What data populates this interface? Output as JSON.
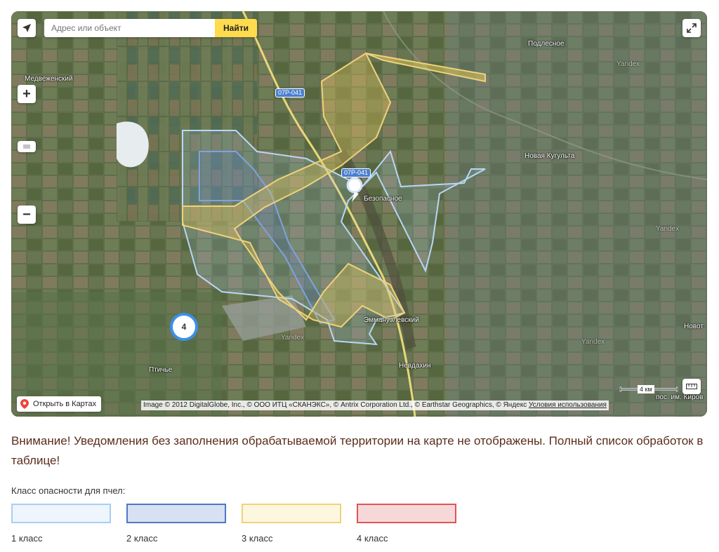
{
  "search": {
    "placeholder": "Адрес или объект",
    "button": "Найти"
  },
  "map_labels": {
    "podlesnoe": "Подлесное",
    "medvezhensky": "Медвеженский",
    "novaya_kugulta": "Новая Кугульта",
    "bezopasnoe": "Безопасное",
    "emmanuelevsky": "Эммануэлевский",
    "novot": "Новот",
    "ptichye": "Птичье",
    "nevdakhin": "Невдахин",
    "pos_im_kirova": "пос. им. Киров",
    "yandex1": "Yandex",
    "yandex2": "Yandex",
    "yandex3": "Yandex",
    "yandex4": "Yandex"
  },
  "road_badges": {
    "r1": "07Р-041",
    "r2": "07Р-041"
  },
  "cluster_count": "4",
  "open_in_maps": "Открыть в Картах",
  "copyright": {
    "text": "Image © 2012 DigitalGlobe, Inc., © ООО ИТЦ «СКАНЭКС», © Antrix Corporation Ltd., © Earthstar Geographics, © Яндекс ",
    "terms": "Условия использования"
  },
  "scale": "4 км",
  "zoom": {
    "plus": "+",
    "minus": "−"
  },
  "warning": "Внимание! Уведомления без заполнения обрабатываемой территории на карте не отображены. Полный список обработок в таблице!",
  "legend": {
    "title": "Класс опасности для пчел:",
    "items": [
      {
        "label": "1 класс",
        "fill": "#eef5fd",
        "border": "#a9cdf2"
      },
      {
        "label": "2 класс",
        "fill": "#d7e1f3",
        "border": "#4c79c4"
      },
      {
        "label": "3 класс",
        "fill": "#fdf7e0",
        "border": "#efd27a"
      },
      {
        "label": "4 класс",
        "fill": "#f7d8d8",
        "border": "#e05555"
      }
    ]
  }
}
